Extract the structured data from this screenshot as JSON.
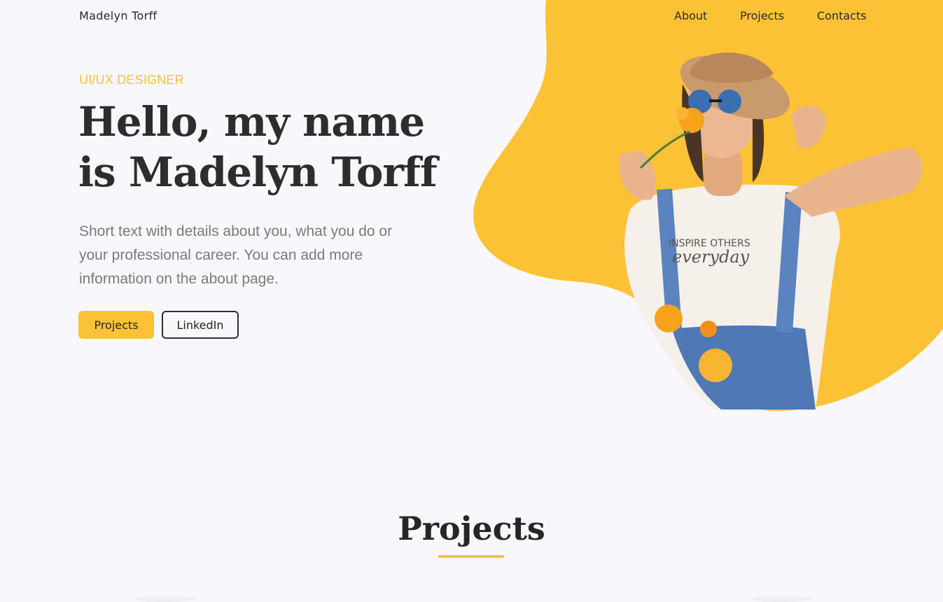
{
  "header": {
    "brand": "Madelyn Torff",
    "nav": [
      "About",
      "Projects",
      "Contacts"
    ]
  },
  "hero": {
    "role": "UI/UX DESIGNER",
    "headline_line1": "Hello,  my name",
    "headline_line2": "is Madelyn Torff",
    "intro": "Short text with details about you, what you do or your professional career. You can add more information on the about page.",
    "buttons": {
      "primary": "Projects",
      "secondary": "LinkedIn"
    },
    "shirt_text_1": "INSPIRE OTHERS",
    "shirt_text_2": "everyday"
  },
  "projects": {
    "title": "Projects"
  },
  "colors": {
    "accent": "#fcc235",
    "background": "#f8f8fc",
    "text": "#2d2d2d",
    "muted": "#7a7a7a"
  }
}
